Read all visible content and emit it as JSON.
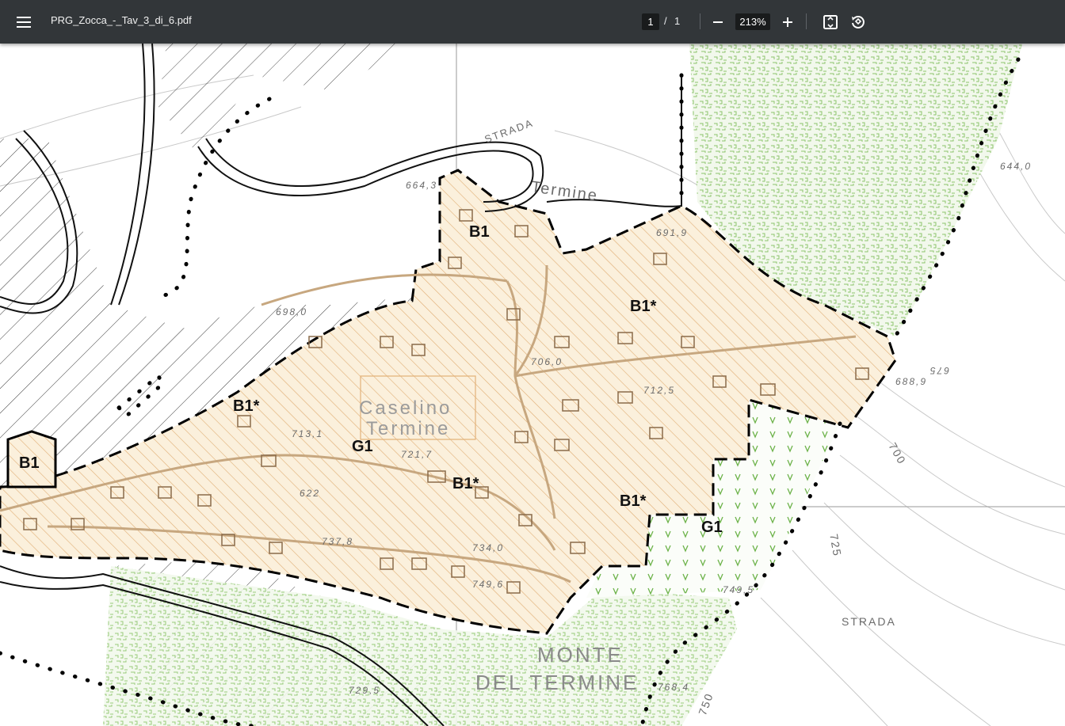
{
  "toolbar": {
    "title": "PRG_Zocca_-_Tav_3_di_6.pdf",
    "page_current": "1",
    "page_separator": "/",
    "page_total": "1",
    "zoom": "213%",
    "icons": [
      "menu-icon",
      "zoom-out-icon",
      "zoom-in-icon",
      "fit-page-icon",
      "rotate-icon"
    ]
  },
  "map": {
    "zone_labels": {
      "b1_top": "B1",
      "b1_left": "B1",
      "b1star_top_right": "B1*",
      "b1star_left": "B1*",
      "b1star_center": "B1*",
      "b1star_right": "B1*",
      "g1_center": "G1",
      "g1_right": "G1"
    },
    "place_labels": {
      "caselino": "Caselino",
      "termine_small": "Termine",
      "termine_top": "Termine",
      "strada_top": "STRADA",
      "strada_right": "STRADA",
      "monte": "MONTE",
      "del_termine": "DEL TERMINE"
    },
    "elevations": [
      "664,3",
      "691,9",
      "698,0",
      "706,0",
      "712,5",
      "688,9",
      "644,0",
      "675",
      "713,1",
      "721,7",
      "622",
      "737,8",
      "734,0",
      "749,6",
      "749,5",
      "768,4",
      "729,5",
      "750",
      "725",
      "700"
    ],
    "colors": {
      "zone_fill": "#f9ecd6",
      "zone_hatch": "#e2b27a",
      "green_pattern": "#7fbf5a",
      "green_fill": "#eef6e6",
      "boundary": "#000000"
    }
  }
}
